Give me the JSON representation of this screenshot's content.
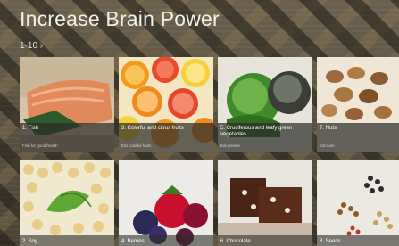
{
  "header": {
    "title": "Increase Brain Power",
    "range": "1-10 ›"
  },
  "tiles_top": [
    {
      "title": "1. Fish",
      "subtitle": "Fish for good health"
    },
    {
      "title": "3. Colorful and citrus fruits",
      "subtitle": "Eat colorful fruits"
    },
    {
      "title": "5. Cruciferous and leafy green vegetables",
      "subtitle": "Eat greens"
    },
    {
      "title": "7. Nuts",
      "subtitle": "Eat nuts"
    }
  ],
  "tiles_bottom": [
    {
      "title": "2. Soy"
    },
    {
      "title": "4. Berries"
    },
    {
      "title": "6. Chocolate"
    },
    {
      "title": "8. Seeds"
    }
  ]
}
